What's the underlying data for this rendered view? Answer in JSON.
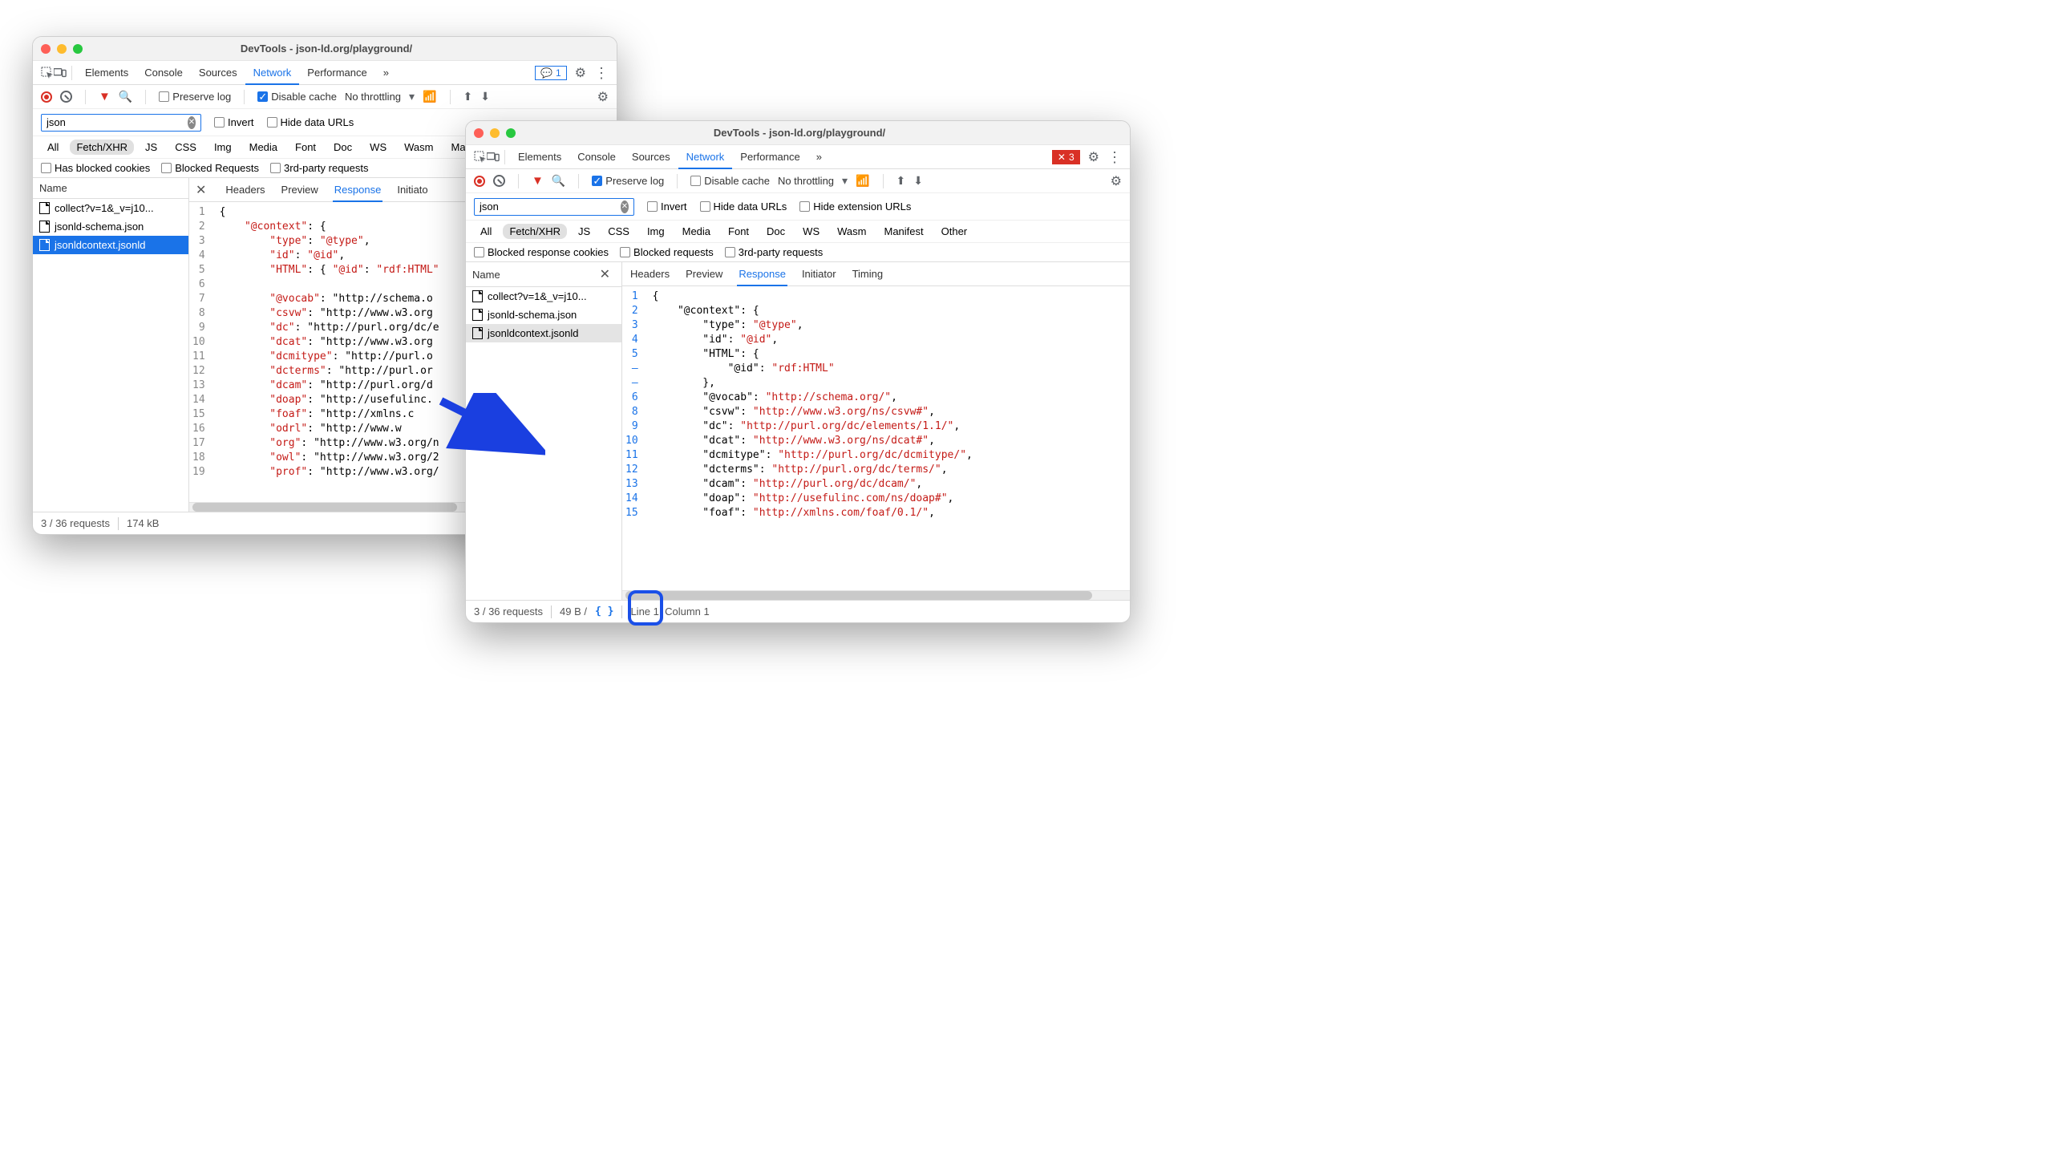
{
  "windows": {
    "left": {
      "title": "DevTools - json-ld.org/playground/",
      "panel_tabs": [
        "Elements",
        "Console",
        "Sources",
        "Network",
        "Performance"
      ],
      "active_panel": "Network",
      "overflow": "»",
      "issue_badge": "1",
      "toolbar": {
        "preserve_log": "Preserve log",
        "preserve_checked": false,
        "disable_cache": "Disable cache",
        "disable_checked": true,
        "throttling": "No throttling"
      },
      "filter": {
        "value": "json",
        "invert": "Invert",
        "hide_data_urls": "Hide data URLs"
      },
      "types": [
        "All",
        "Fetch/XHR",
        "JS",
        "CSS",
        "Img",
        "Media",
        "Font",
        "Doc",
        "WS",
        "Wasm",
        "Manifest"
      ],
      "type_selected": "Fetch/XHR",
      "extra": [
        "Has blocked cookies",
        "Blocked Requests",
        "3rd-party requests"
      ],
      "sidebar_header": "Name",
      "requests": [
        {
          "name": "collect?v=1&_v=j10...",
          "sel": ""
        },
        {
          "name": "jsonld-schema.json",
          "sel": ""
        },
        {
          "name": "jsonldcontext.jsonld",
          "sel": "blue"
        }
      ],
      "detail_tabs": [
        "Headers",
        "Preview",
        "Response",
        "Initiato"
      ],
      "detail_active": "Response",
      "code_lines": [
        "{",
        "    \"@context\": {",
        "        \"type\": \"@type\",",
        "        \"id\": \"@id\",",
        "        \"HTML\": { \"@id\": \"rdf:HTML\"",
        "",
        "        \"@vocab\": \"http://schema.o",
        "        \"csvw\": \"http://www.w3.org",
        "        \"dc\": \"http://purl.org/dc/e",
        "        \"dcat\": \"http://www.w3.org",
        "        \"dcmitype\": \"http://purl.o",
        "        \"dcterms\": \"http://purl.or",
        "        \"dcam\": \"http://purl.org/d",
        "        \"doap\": \"http://usefulinc.",
        "        \"foaf\": \"http://xmlns.c",
        "        \"odrl\": \"http://www.w",
        "        \"org\": \"http://www.w3.org/n",
        "        \"owl\": \"http://www.w3.org/2",
        "        \"prof\": \"http://www.w3.org/"
      ],
      "status": {
        "requests": "3 / 36 requests",
        "size": "174 kB"
      }
    },
    "right": {
      "title": "DevTools - json-ld.org/playground/",
      "panel_tabs": [
        "Elements",
        "Console",
        "Sources",
        "Network",
        "Performance"
      ],
      "active_panel": "Network",
      "overflow": "»",
      "issue_badge": "3",
      "toolbar": {
        "preserve_log": "Preserve log",
        "preserve_checked": true,
        "disable_cache": "Disable cache",
        "disable_checked": false,
        "throttling": "No throttling"
      },
      "filter": {
        "value": "json",
        "invert": "Invert",
        "hide_data_urls": "Hide data URLs",
        "hide_ext_urls": "Hide extension URLs"
      },
      "types": [
        "All",
        "Fetch/XHR",
        "JS",
        "CSS",
        "Img",
        "Media",
        "Font",
        "Doc",
        "WS",
        "Wasm",
        "Manifest",
        "Other"
      ],
      "type_selected": "Fetch/XHR",
      "extra": [
        "Blocked response cookies",
        "Blocked requests",
        "3rd-party requests"
      ],
      "sidebar_header": "Name",
      "requests": [
        {
          "name": "collect?v=1&_v=j10...",
          "sel": ""
        },
        {
          "name": "jsonld-schema.json",
          "sel": ""
        },
        {
          "name": "jsonldcontext.jsonld",
          "sel": "grey"
        }
      ],
      "detail_tabs": [
        "Headers",
        "Preview",
        "Response",
        "Initiator",
        "Timing"
      ],
      "detail_active": "Response",
      "gutter": [
        "1",
        "2",
        "3",
        "4",
        "5",
        "–",
        "–",
        "6",
        "8",
        "9",
        "10",
        "11",
        "12",
        "13",
        "14",
        "15"
      ],
      "code_pretty": [
        {
          "i": 0,
          "t": "{"
        },
        {
          "i": 1,
          "k": "\"@context\"",
          "t": ": {"
        },
        {
          "i": 2,
          "k": "\"type\"",
          "t": ": ",
          "v": "\"@type\"",
          "p": ","
        },
        {
          "i": 2,
          "k": "\"id\"",
          "t": ": ",
          "v": "\"@id\"",
          "p": ","
        },
        {
          "i": 2,
          "k": "\"HTML\"",
          "t": ": {"
        },
        {
          "i": 3,
          "k": "\"@id\"",
          "t": ": ",
          "v": "\"rdf:HTML\""
        },
        {
          "i": 2,
          "t": "},"
        },
        {
          "i": 2,
          "k": "\"@vocab\"",
          "t": ": ",
          "v": "\"http://schema.org/\"",
          "p": ","
        },
        {
          "i": 2,
          "k": "\"csvw\"",
          "t": ": ",
          "v": "\"http://www.w3.org/ns/csvw#\"",
          "p": ","
        },
        {
          "i": 2,
          "k": "\"dc\"",
          "t": ": ",
          "v": "\"http://purl.org/dc/elements/1.1/\"",
          "p": ","
        },
        {
          "i": 2,
          "k": "\"dcat\"",
          "t": ": ",
          "v": "\"http://www.w3.org/ns/dcat#\"",
          "p": ","
        },
        {
          "i": 2,
          "k": "\"dcmitype\"",
          "t": ": ",
          "v": "\"http://purl.org/dc/dcmitype/\"",
          "p": ","
        },
        {
          "i": 2,
          "k": "\"dcterms\"",
          "t": ": ",
          "v": "\"http://purl.org/dc/terms/\"",
          "p": ","
        },
        {
          "i": 2,
          "k": "\"dcam\"",
          "t": ": ",
          "v": "\"http://purl.org/dc/dcam/\"",
          "p": ","
        },
        {
          "i": 2,
          "k": "\"doap\"",
          "t": ": ",
          "v": "\"http://usefulinc.com/ns/doap#\"",
          "p": ","
        },
        {
          "i": 2,
          "k": "\"foaf\"",
          "t": ": ",
          "v": "\"http://xmlns.com/foaf/0.1/\"",
          "p": ","
        }
      ],
      "status": {
        "requests": "3 / 36 requests",
        "size": "49 B /",
        "pos": "Line 1, Column 1"
      }
    }
  }
}
